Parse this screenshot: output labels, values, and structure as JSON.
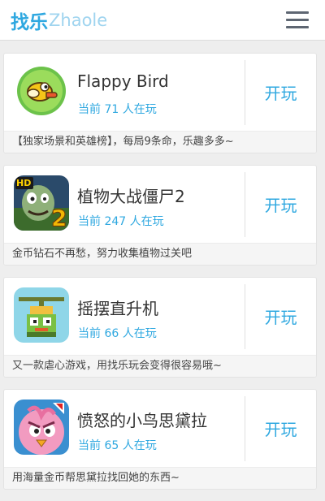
{
  "header": {
    "logo_cn": "找乐",
    "logo_en": "Zhaole",
    "menu_icon": "hamburger-menu-icon"
  },
  "games": [
    {
      "name": "Flappy Bird",
      "players": "当前 71 人在玩",
      "play_label": "开玩",
      "description": "【独家场景和英雄榜】，每局9条命，乐趣多多~",
      "icon": "flappy-bird-icon"
    },
    {
      "name": "植物大战僵尸2",
      "players": "当前 247 人在玩",
      "play_label": "开玩",
      "description": "金币钻石不再愁，努力收集植物过关吧",
      "icon": "plants-vs-zombies-icon",
      "icon_badge_text": "HD"
    },
    {
      "name": "摇摆直升机",
      "players": "当前 66 人在玩",
      "play_label": "开玩",
      "description": "又一款虐心游戏，用找乐玩会变得很容易哦~",
      "icon": "swing-copters-icon"
    },
    {
      "name": "愤怒的小鸟思黛拉",
      "players": "当前 65 人在玩",
      "play_label": "开玩",
      "description": "用海量金币帮思黛拉找回她的东西~",
      "icon": "angry-birds-stella-icon"
    }
  ],
  "colors": {
    "accent": "#2fa8e0",
    "logo_light": "#9fd4ef",
    "text": "#333333",
    "background": "#eeeeee"
  }
}
